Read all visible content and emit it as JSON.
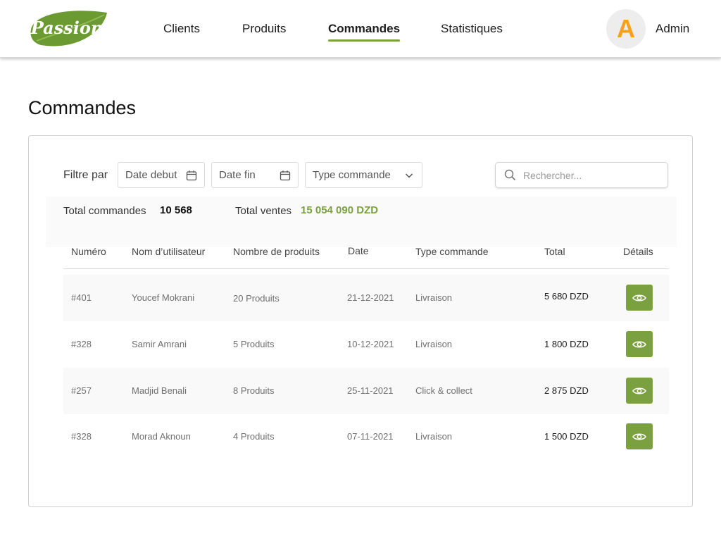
{
  "header": {
    "logo_text": "Passion",
    "nav": [
      {
        "label": "Clients",
        "active": false
      },
      {
        "label": "Produits",
        "active": false
      },
      {
        "label": "Commandes",
        "active": true
      },
      {
        "label": "Statistiques",
        "active": false
      }
    ],
    "avatar_letter": "A",
    "user_name": "Admin"
  },
  "page": {
    "title": "Commandes"
  },
  "filters": {
    "label": "Filtre par",
    "date_start": "Date debut",
    "date_end": "Date fin",
    "order_type": "Type commande",
    "search_placeholder": "Rechercher..."
  },
  "stats": {
    "total_orders_label": "Total commandes",
    "total_orders_value": "10 568",
    "total_sales_label": "Total ventes",
    "total_sales_value": "15 054 090 DZD"
  },
  "table": {
    "columns": [
      "Numéro",
      "Nom d’utilisateur",
      "Nombre de produits",
      "Date",
      "Type commande",
      "Total",
      "Détails"
    ],
    "rows": [
      {
        "id": "#401",
        "user": "Youcef Mokrani",
        "products": "20 Produits",
        "date": "21-12-2021",
        "type": "Livraison",
        "total": "5 680 DZD"
      },
      {
        "id": "#328",
        "user": "Samir Amrani",
        "products": "5 Produits",
        "date": "10-12-2021",
        "type": "Livraison",
        "total": "1 800 DZD"
      },
      {
        "id": "#257",
        "user": "Madjid Benali",
        "products": "8 Produits",
        "date": "25-11-2021",
        "type": "Click & collect",
        "total": "2 875 DZD"
      },
      {
        "id": "#328",
        "user": "Morad Aknoun",
        "products": "4 Produits",
        "date": "07-11-2021",
        "type": "Livraison",
        "total": "1 500 DZD"
      }
    ]
  },
  "colors": {
    "accent": "#7aa03f",
    "avatar_letter": "#f5a21a",
    "logo_green": "#6b9a32"
  },
  "icons": {
    "date": "calendar-icon",
    "type": "chevron-down-icon",
    "search": "search-icon",
    "details": "eye-icon"
  }
}
